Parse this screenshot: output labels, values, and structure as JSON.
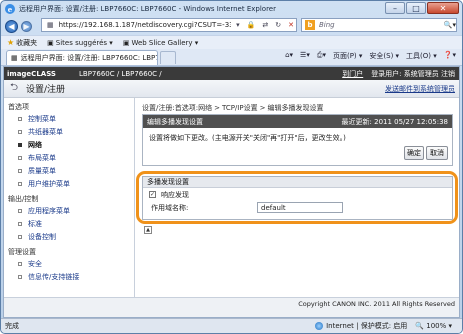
{
  "window": {
    "title": "远程用户界面: 设置/注册: LBP7660C: LBP7660C - Windows Internet Explorer",
    "min": "–",
    "max": "□",
    "close": "✕"
  },
  "browser": {
    "url": "https://192.168.1.187/netdiscovery.cgi?CSUT=-335467831",
    "search_placeholder": "Bing",
    "favorites_label": "收藏夹",
    "fav_items": [
      "Sites suggérés ▾",
      "Web Slice Gallery ▾"
    ],
    "tab_title": "远程用户界面: 设置/注册: LBP7660C: LBP7660C",
    "cmd": [
      "页面(P) ▾",
      "安全(S) ▾",
      "工具(O) ▾",
      "❓▾"
    ],
    "status_done": "完成",
    "status_zone": "Internet | 保护模式: 启用",
    "status_zoom": "🔍 100% ▾"
  },
  "banner": {
    "brand": "imageCLASS",
    "model": "LBP7660C / LBP7660C /",
    "portal_link": "到门户",
    "user": "登录用户: 系统管理员 注销"
  },
  "header": {
    "title": "设置/注册",
    "send_link": "发送邮件到系统管理员"
  },
  "sidebar": {
    "sec_pref": "首选项",
    "pref_items": [
      "控制菜单",
      "共纸器菜单",
      "网络",
      "布局菜单",
      "质量菜单",
      "用户维护菜单"
    ],
    "sec_io": "输出/控制",
    "io_items": [
      "应用程序菜单",
      "标准",
      "设备控制"
    ],
    "sec_mgmt": "管理设置",
    "mgmt_items": [
      "安全",
      "信息传/支持链接"
    ]
  },
  "breadcrumb": [
    "设置/注册:首选项:网络",
    "TCP/IP设置",
    "编辑多播发现设置"
  ],
  "edit": {
    "title": "编辑多播发现设置",
    "last_update": "最近更新: 2011 05/27 12:05:38",
    "note": "设置将做如下更改。(主电源开关\"关闭\"再\"打开\"后，更改生效。)",
    "ok": "确定",
    "cancel": "取消"
  },
  "settings": {
    "title": "多播发现设置",
    "respond_label": "响应发现",
    "respond_checked": "✓",
    "scope_label": "作用域名称:",
    "scope_value": "default"
  },
  "footer": {
    "copyright": "Copyright CANON INC. 2011 All Rights Reserved"
  }
}
